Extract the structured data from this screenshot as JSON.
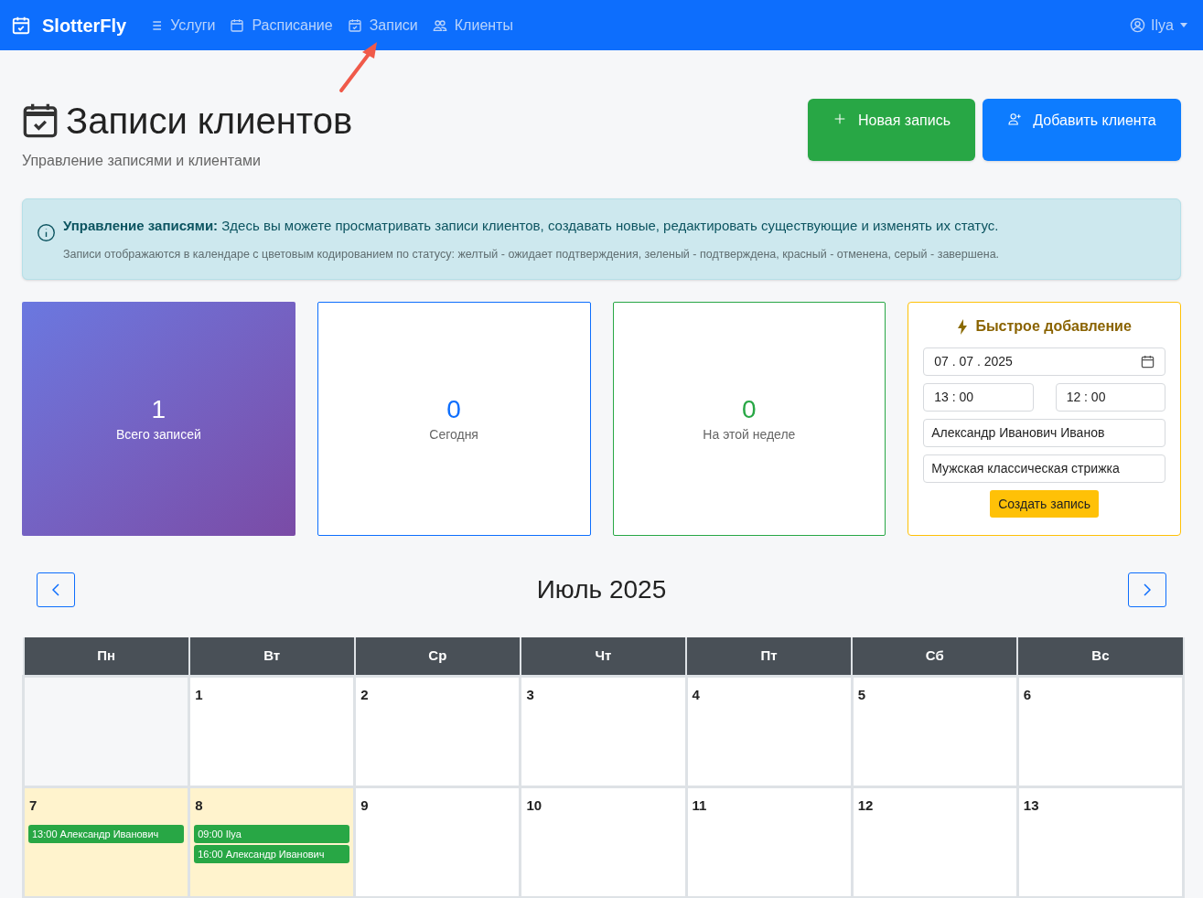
{
  "navbar": {
    "brand": "SlotterFly",
    "items": [
      {
        "label": "Услуги"
      },
      {
        "label": "Расписание"
      },
      {
        "label": "Записи"
      },
      {
        "label": "Клиенты"
      }
    ],
    "user": "Ilya"
  },
  "header": {
    "title": "Записи клиентов",
    "subtitle": "Управление записями и клиентами",
    "buttons": [
      {
        "label": "Новая запись",
        "kind": "new"
      },
      {
        "label": "Добавить клиента",
        "kind": "client"
      }
    ]
  },
  "alert": {
    "text": "**Управление записями:** Здесь вы можете просматривать записи клиентов, создавать новые, редактировать существующие и изменять их статус.",
    "note": "Записи отображаются в календаре с цветовым кодированием по статусу: желтый - ожидает подтверждения, зеленый - подтверждена, красный - отменена, серый - завершена."
  },
  "stats": [
    {
      "value": "1",
      "label": "Всего записей",
      "kind": "total"
    },
    {
      "value": "0",
      "label": "Сегодня",
      "kind": "today"
    },
    {
      "value": "0",
      "label": "На этой неделе",
      "kind": "week"
    }
  ],
  "quick_add": {
    "title": "Быстрое добавление",
    "date": "07 . 07 . 2025",
    "time_start": "13 : 00",
    "time_end": "12 : 00",
    "client": "Александр Иванович Иванов",
    "service": "Мужская классическая стрижка",
    "button": "Создать запись"
  },
  "calendar": {
    "month": "Июль 2025",
    "weekdays": [
      "Пн",
      "Вт",
      "Ср",
      "Чт",
      "Пт",
      "Сб",
      "Вс"
    ],
    "weeks": [
      [
        {
          "highlighted": false
        },
        {
          "day": "1",
          "highlighted": false
        },
        {
          "day": "2",
          "highlighted": false
        },
        {
          "day": "3",
          "highlighted": false
        },
        {
          "day": "4",
          "highlighted": false
        },
        {
          "day": "5",
          "highlighted": false
        },
        {
          "day": "6",
          "highlighted": false
        }
      ],
      [
        {
          "day": "7",
          "highlighted": true,
          "events": [
            {
              "text": "13:00 Александр Иванович",
              "color": "#28a745"
            }
          ]
        },
        {
          "day": "8",
          "highlighted": true,
          "events": [
            {
              "text": "09:00 Ilya",
              "color": "#28a745"
            },
            {
              "text": "16:00 Александр Иванович",
              "color": "#28a745"
            }
          ]
        },
        {
          "day": "9",
          "highlighted": false
        },
        {
          "day": "10",
          "highlighted": false
        },
        {
          "day": "11",
          "highlighted": false
        },
        {
          "day": "12",
          "highlighted": false
        },
        {
          "day": "13",
          "highlighted": false
        }
      ]
    ]
  }
}
